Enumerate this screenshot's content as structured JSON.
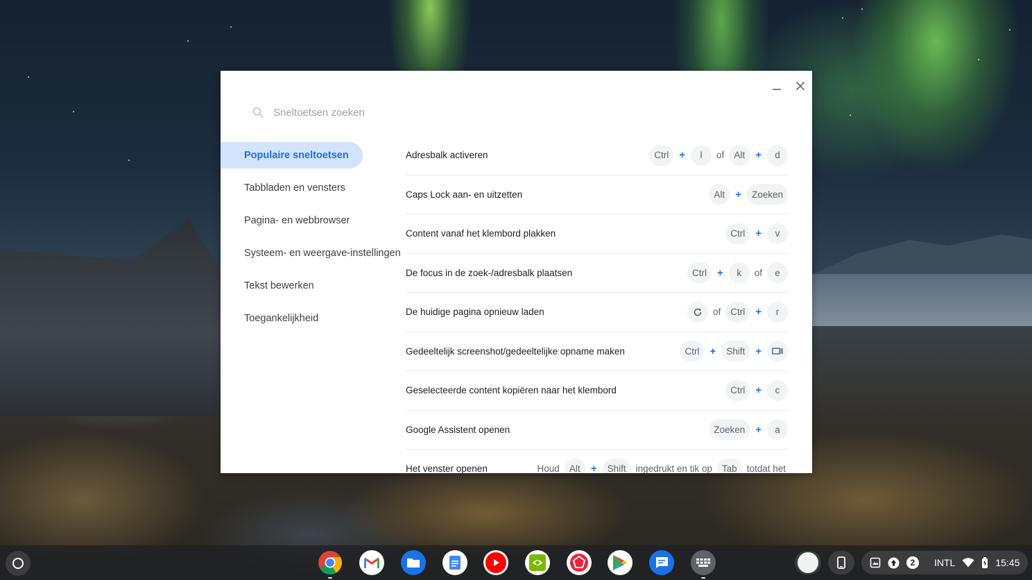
{
  "dialog": {
    "search_placeholder": "Sneltoetsen zoeken",
    "minimize_icon": "minimize-icon",
    "close_icon": "close-icon"
  },
  "sidebar": {
    "items": [
      {
        "label": "Populaire sneltoetsen",
        "active": true
      },
      {
        "label": "Tabbladen en vensters",
        "active": false
      },
      {
        "label": "Pagina- en webbrowser",
        "active": false
      },
      {
        "label": "Systeem- en weergave-instellingen",
        "active": false
      },
      {
        "label": "Tekst bewerken",
        "active": false
      },
      {
        "label": "Toegankelijkheid",
        "active": false
      }
    ]
  },
  "shortcuts": [
    {
      "label": "Adresbalk activeren",
      "keys": [
        "Ctrl",
        "+",
        "l",
        "of",
        "Alt",
        "+",
        "d"
      ]
    },
    {
      "label": "Caps Lock aan- en uitzetten",
      "keys": [
        "Alt",
        "+",
        "Zoeken"
      ]
    },
    {
      "label": "Content vanaf het klembord plakken",
      "keys": [
        "Ctrl",
        "+",
        "v"
      ]
    },
    {
      "label": "De focus in de zoek-/adresbalk plaatsen",
      "keys": [
        "Ctrl",
        "+",
        "k",
        "of",
        "e"
      ]
    },
    {
      "label": "De huidige pagina opnieuw laden",
      "keys": [
        "reload-icon",
        "of",
        "Ctrl",
        "+",
        "r"
      ]
    },
    {
      "label": "Gedeeltelijk screenshot/gedeeltelijke opname maken",
      "keys": [
        "Ctrl",
        "+",
        "Shift",
        "+",
        "overview-icon"
      ]
    },
    {
      "label": "Geselecteerde content kopiëren naar het klembord",
      "keys": [
        "Ctrl",
        "+",
        "c"
      ]
    },
    {
      "label": "Google Assistent openen",
      "keys": [
        "Zoeken",
        "+",
        "a"
      ]
    },
    {
      "label": "Het venster openen",
      "keys": [
        "Houd",
        "Alt",
        "+",
        "Shift",
        "ingedrukt en tik op",
        "Tab",
        "totdat het"
      ]
    }
  ],
  "shelf": {
    "apps": [
      "chrome-icon",
      "gmail-icon",
      "files-icon",
      "docs-icon",
      "youtube-icon",
      "geforce-now-icon",
      "app-red-icon",
      "play-store-icon",
      "messages-icon",
      "shortcuts-app-icon"
    ],
    "tray": {
      "input_method": "INTL",
      "notification_count": "2",
      "time": "15:45"
    }
  },
  "colors": {
    "accent": "#1a73e8",
    "active_bg": "#d3e3fd",
    "key_bg": "#f1f3f4"
  }
}
